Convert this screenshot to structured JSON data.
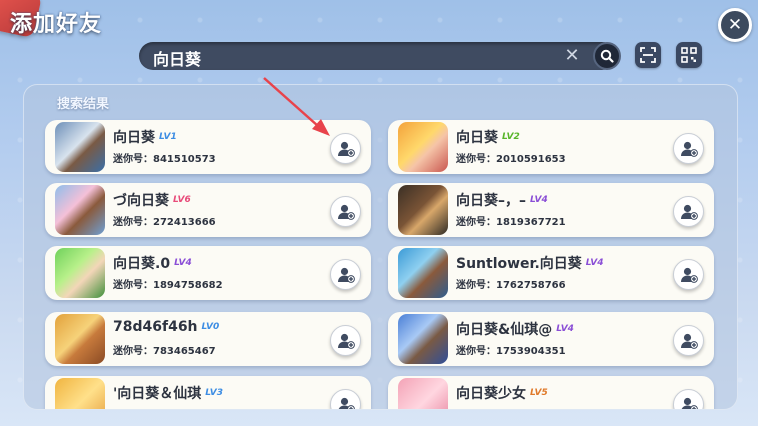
{
  "header": {
    "title": "添加好友"
  },
  "search": {
    "value": "向日葵"
  },
  "results": {
    "title": "搜索结果",
    "id_prefix": "迷你号：",
    "items": [
      {
        "name": "向日葵",
        "level": "LV1",
        "level_color": "#3d8de3",
        "id": "841510573"
      },
      {
        "name": "向日葵",
        "level": "LV2",
        "level_color": "#58b52a",
        "id": "2010591653"
      },
      {
        "name": "づ向日葵",
        "level": "LV6",
        "level_color": "#e84c7a",
        "id": "272413666"
      },
      {
        "name": "向日葵–，–",
        "level": "LV4",
        "level_color": "#8a4ed6",
        "id": "1819367721"
      },
      {
        "name": "向日葵.0",
        "level": "LV4",
        "level_color": "#8a4ed6",
        "id": "1894758682"
      },
      {
        "name": "Suntlower.向日葵",
        "level": "LV4",
        "level_color": "#8a4ed6",
        "id": "1762758766"
      },
      {
        "name": "78d46f46h",
        "level": "LV0",
        "level_color": "#3d8de3",
        "id": "783465467"
      },
      {
        "name": "向日葵&仙琪@",
        "level": "LV4",
        "level_color": "#8a4ed6",
        "id": "1753904351"
      },
      {
        "name": "'向日葵＆仙琪",
        "level": "LV3",
        "level_color": "#3d8de3",
        "id": ""
      },
      {
        "name": "向日葵少女",
        "level": "LV5",
        "level_color": "#e07a2a",
        "id": ""
      }
    ]
  },
  "colors": {
    "accent_arrow": "#e8434b",
    "panel_bg": "#b2c4de"
  }
}
